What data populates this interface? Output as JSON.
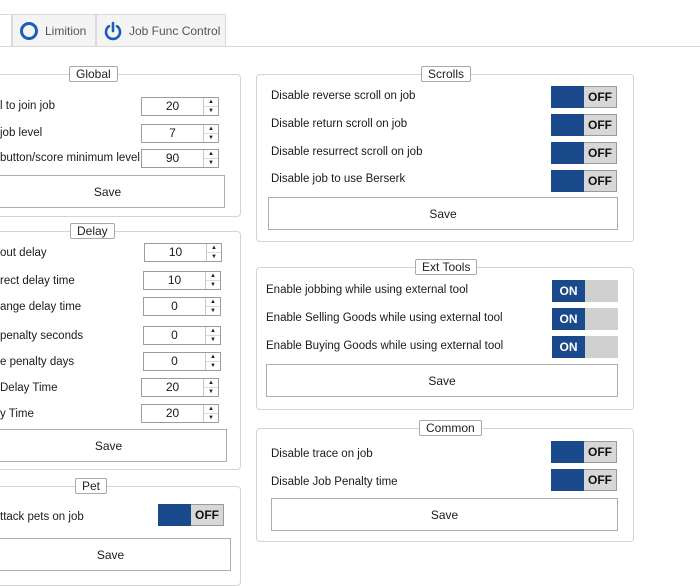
{
  "tabs": [
    {
      "label": ""
    },
    {
      "label": "Limition"
    },
    {
      "label": "Job Func Control"
    }
  ],
  "global": {
    "legend": "Global",
    "rows": [
      {
        "label": "l to join job",
        "value": "20"
      },
      {
        "label": "job level",
        "value": "7"
      },
      {
        "label": "button/score minimum level",
        "value": "90"
      }
    ],
    "save": "Save"
  },
  "delay": {
    "legend": "Delay",
    "rows": [
      {
        "label": "out delay",
        "value": "10"
      },
      {
        "label": "rect delay time",
        "value": "10"
      },
      {
        "label": "ange delay time",
        "value": "0"
      },
      {
        "label": "penalty seconds",
        "value": "0"
      },
      {
        "label": "e penalty days",
        "value": "0"
      },
      {
        "label": "Delay Time",
        "value": "20"
      },
      {
        "label": "y Time",
        "value": "20"
      }
    ],
    "save": "Save"
  },
  "pet": {
    "legend": "Pet",
    "rows": [
      {
        "label": "ttack pets on job",
        "state": "OFF"
      }
    ],
    "save": "Save"
  },
  "scrolls": {
    "legend": "Scrolls",
    "rows": [
      {
        "label": "Disable reverse scroll on job",
        "state": "OFF"
      },
      {
        "label": "Disable return scroll on job",
        "state": "OFF"
      },
      {
        "label": "Disable resurrect scroll on job",
        "state": "OFF"
      },
      {
        "label": "Disable job to use Berserk",
        "state": "OFF"
      }
    ],
    "save": "Save"
  },
  "ext_tools": {
    "legend": "Ext Tools",
    "rows": [
      {
        "label": "Enable jobbing while using external tool",
        "state": "ON"
      },
      {
        "label": "Enable Selling Goods while using external tool",
        "state": "ON"
      },
      {
        "label": "Enable Buying Goods while using external tool",
        "state": "ON"
      }
    ],
    "save": "Save"
  },
  "common": {
    "legend": "Common",
    "rows": [
      {
        "label": "Disable trace on job",
        "state": "OFF"
      },
      {
        "label": "Disable Job Penalty time",
        "state": "OFF"
      }
    ],
    "save": "Save"
  },
  "colors": {
    "toggle_blue": "#1b4a8c",
    "toggle_grey": "#d7d7d7",
    "tab_icon_blue": "#1a5fb4"
  },
  "icons": {
    "limition_tab": "circle-icon",
    "job_func_tab": "power-icon"
  }
}
